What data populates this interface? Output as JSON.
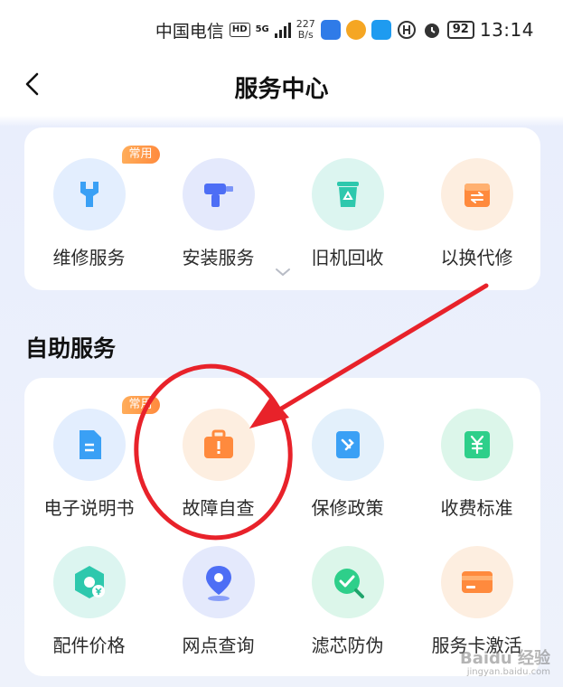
{
  "status_bar": {
    "carrier": "中国电信",
    "hd": "HD",
    "network": "5G",
    "speed_value": "227",
    "speed_unit": "B/s",
    "battery": "92",
    "time": "13:14"
  },
  "header": {
    "title": "服务中心",
    "back_icon": "chevron-left-icon"
  },
  "top_services": {
    "items": [
      {
        "label": "维修服务",
        "tag": "常用",
        "icon": "wrench-icon",
        "color": "#3aa0f5"
      },
      {
        "label": "安装服务",
        "tag": "",
        "icon": "drill-icon",
        "color": "#4d6ef5"
      },
      {
        "label": "旧机回收",
        "tag": "",
        "icon": "recycle-bin-icon",
        "color": "#2ec8ad"
      },
      {
        "label": "以换代修",
        "tag": "",
        "icon": "exchange-box-icon",
        "color": "#ff8a3d"
      }
    ],
    "expand_icon": "chevron-down-icon"
  },
  "self_service": {
    "title": "自助服务",
    "items": [
      {
        "label": "电子说明书",
        "tag": "常用",
        "icon": "document-icon",
        "color": "#3aa0f5"
      },
      {
        "label": "故障自查",
        "tag": "",
        "icon": "toolbox-alert-icon",
        "color": "#ff8a3d"
      },
      {
        "label": "保修政策",
        "tag": "",
        "icon": "warranty-icon",
        "color": "#3aa0f5"
      },
      {
        "label": "收费标准",
        "tag": "",
        "icon": "yuan-icon",
        "color": "#2ecf8a"
      },
      {
        "label": "配件价格",
        "tag": "",
        "icon": "parts-price-icon",
        "color": "#2ec8ad"
      },
      {
        "label": "网点查询",
        "tag": "",
        "icon": "location-pin-icon",
        "color": "#4d6ef5"
      },
      {
        "label": "滤芯防伪",
        "tag": "",
        "icon": "filter-verify-icon",
        "color": "#2ecf8a"
      },
      {
        "label": "服务卡激活",
        "tag": "",
        "icon": "card-icon",
        "color": "#ff8a3d"
      }
    ]
  },
  "annotation": {
    "color": "#e8222a",
    "shapes": [
      "ellipse-highlight",
      "arrow"
    ]
  },
  "watermark": {
    "line1": "Baidu 经验",
    "line2": "jingyan.baidu.com"
  }
}
